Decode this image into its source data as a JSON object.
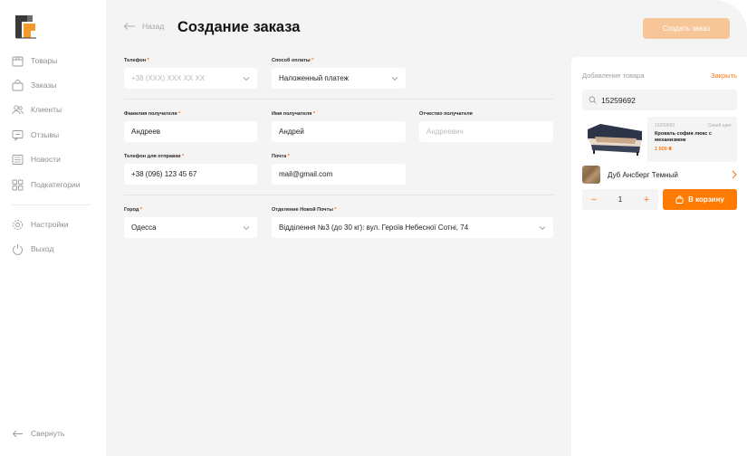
{
  "sidebar": {
    "items": [
      {
        "label": "Товары",
        "icon": "box-icon"
      },
      {
        "label": "Заказы",
        "icon": "bag-icon"
      },
      {
        "label": "Клиенты",
        "icon": "users-icon"
      },
      {
        "label": "Отзывы",
        "icon": "chat-icon"
      },
      {
        "label": "Новости",
        "icon": "newspaper-icon"
      },
      {
        "label": "Подкатегории",
        "icon": "grid-icon"
      }
    ],
    "settings": "Настройки",
    "logout": "Выход",
    "collapse": "Свернуть"
  },
  "header": {
    "back": "Назад",
    "title": "Создание заказа",
    "create_button": "Создать заказ"
  },
  "form": {
    "phone": {
      "label": "Телефон",
      "placeholder": "+38 (XXX) XXX XX XX"
    },
    "payment": {
      "label": "Способ оплаты",
      "value": "Наложенный платеж"
    },
    "last_name": {
      "label": "Фамилия получателя",
      "value": "Андреев"
    },
    "first_name": {
      "label": "Имя получателя",
      "value": "Андрей"
    },
    "patronymic": {
      "label": "Отчество получателя",
      "placeholder": "Андреевич"
    },
    "sender_phone": {
      "label": "Телефон для отправки",
      "value": "+38 (096) 123 45 67"
    },
    "email": {
      "label": "Почта",
      "value": "mail@gmail.com"
    },
    "city": {
      "label": "Город",
      "value": "Одесса"
    },
    "branch": {
      "label": "Отделение Новой Почты",
      "value": "Відділення №3 (до 30 кг): вул. Героїв Небесної Сотні, 74"
    },
    "required_mark": "*"
  },
  "panel": {
    "title": "Добавление товара",
    "close": "Закрыть",
    "search_value": "15259692",
    "product": {
      "sku": "15259692",
      "color": "Синий цвет",
      "name": "Кровать софия люкс с механизмом",
      "price": "1 500 ₴"
    },
    "variant": "Дуб Ансберг Темный",
    "quantity": "1",
    "minus": "−",
    "plus": "+",
    "cart_button": "В корзину"
  },
  "colors": {
    "accent": "#ff7a00",
    "accent_disabled": "#f7c698",
    "background": "#f3f4f3"
  }
}
